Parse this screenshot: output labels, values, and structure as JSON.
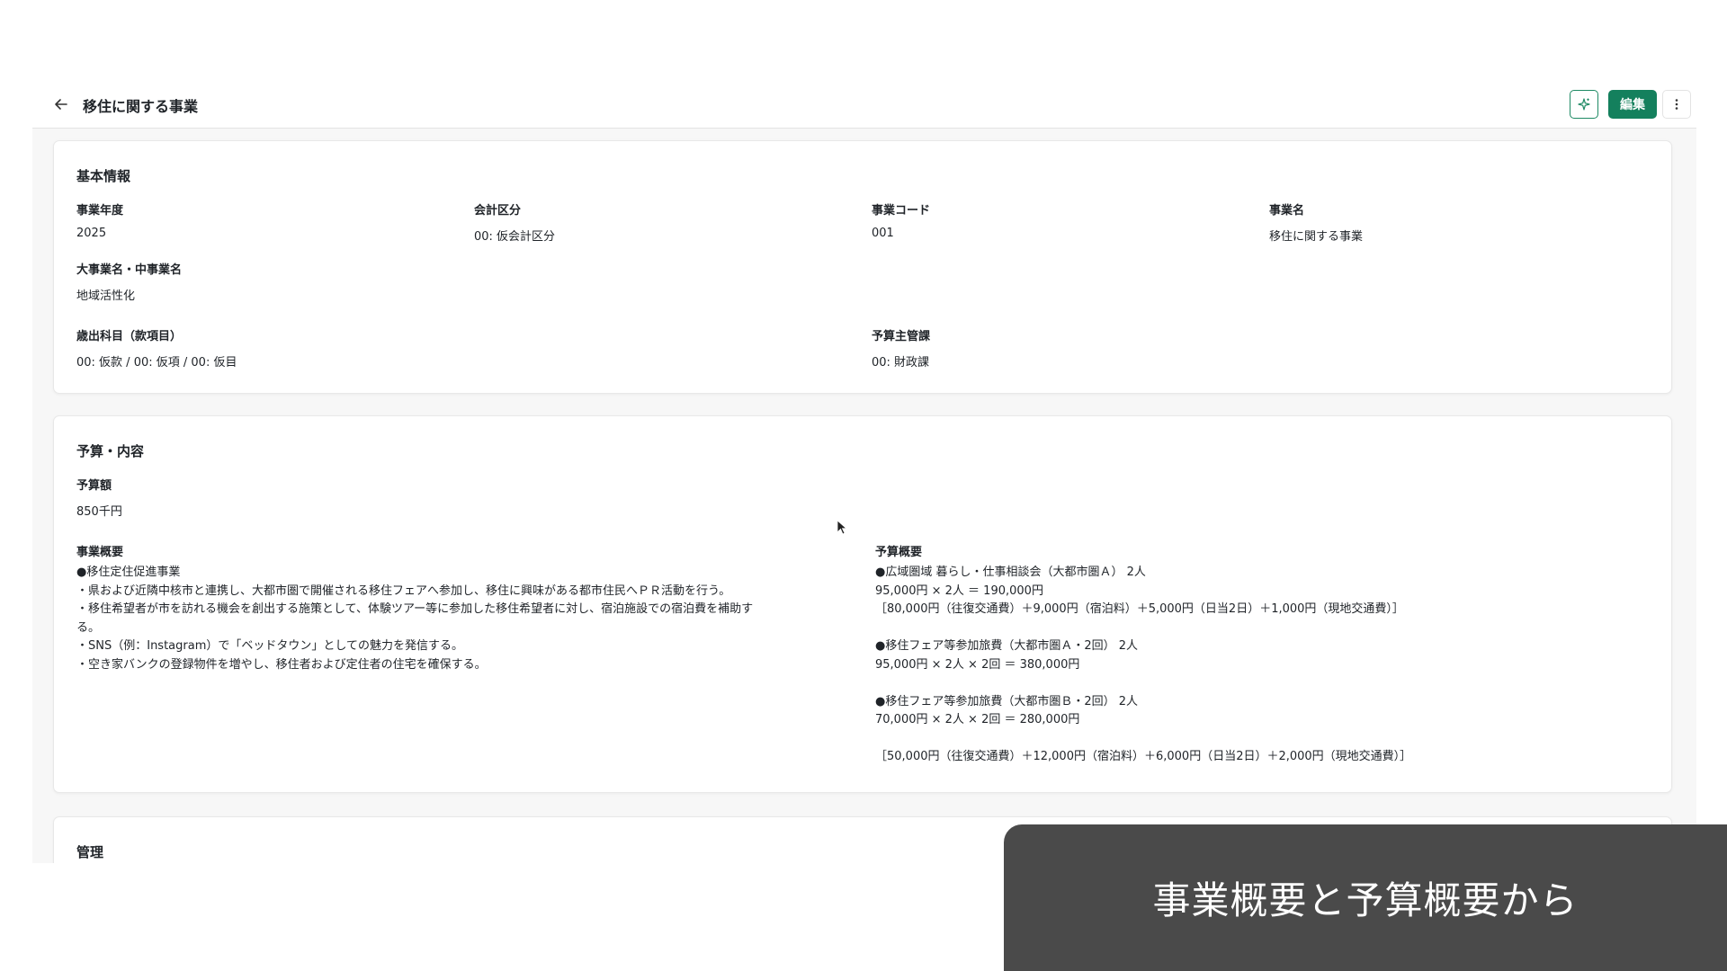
{
  "header": {
    "title": "移住に関する事業",
    "edit_label": "編集"
  },
  "basic_info": {
    "title": "基本情報",
    "fiscal_year": {
      "label": "事業年度",
      "value": "2025"
    },
    "accounting": {
      "label": "会計区分",
      "value": "00: 仮会計区分"
    },
    "project_code": {
      "label": "事業コード",
      "value": "001"
    },
    "project_name": {
      "label": "事業名",
      "value": "移住に関する事業"
    },
    "major_project": {
      "label": "大事業名・中事業名",
      "value": "地域活性化"
    },
    "expenditure": {
      "label": "歳出科目（款項目）",
      "value": "00: 仮款 / 00: 仮項 / 00: 仮目"
    },
    "budget_dept": {
      "label": "予算主管課",
      "value": "00: 財政課"
    }
  },
  "budget": {
    "title": "予算・内容",
    "amount": {
      "label": "予算額",
      "value": "850千円"
    },
    "overview": {
      "label": "事業概要",
      "lines": [
        "●移住定住促進事業",
        "・県および近隣中核市と連携し、大都市圏で開催される移住フェアへ参加し、移住に興味がある都市住民へＰＲ活動を行う。",
        "・移住希望者が市を訪れる機会を創出する施策として、体験ツアー等に参加した移住希望者に対し、宿泊施設での宿泊費を補助す",
        "る。",
        "・SNS（例：Instagram）で「ベッドタウン」としての魅力を発信する。",
        "・空き家バンクの登録物件を増やし、移住者および定住者の住宅を確保する。"
      ]
    },
    "budget_summary": {
      "label": "予算概要",
      "lines": [
        "●広域圏域 暮らし・仕事相談会（大都市圏Ａ） 2人",
        "95,000円 × 2人 ＝ 190,000円",
        "［80,000円（往復交通費）＋9,000円（宿泊料）＋5,000円（日当2日）＋1,000円（現地交通費）］",
        "",
        "●移住フェア等参加旅費（大都市圏Ａ・2回） 2人",
        "95,000円 × 2人 × 2回 ＝ 380,000円",
        "",
        "●移住フェア等参加旅費（大都市圏Ｂ・2回） 2人",
        "70,000円 × 2人 × 2回 ＝ 280,000円",
        "",
        "［50,000円（往復交通費）＋12,000円（宿泊料）＋6,000円（日当2日）＋2,000円（現地交通費）］"
      ]
    }
  },
  "management": {
    "title": "管理"
  },
  "caption": {
    "text": "事業概要と予算概要から"
  },
  "icons": {
    "back": "arrow-left-icon",
    "sparkle": "sparkle-icon",
    "more": "more-vertical-icon",
    "cursor": "mouse-cursor-icon"
  },
  "colors": {
    "accent": "#14805d",
    "caption_bg": "#4a4a4a"
  }
}
